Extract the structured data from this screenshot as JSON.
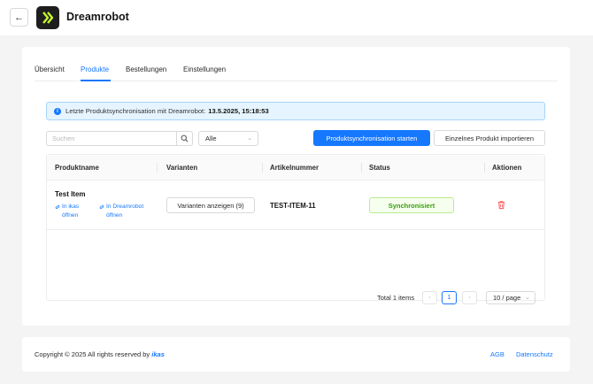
{
  "header": {
    "back_icon": "arrow-left-icon",
    "logo_icon": "double-chevron-right-icon",
    "title": "Dreamrobot"
  },
  "tabs": [
    {
      "label": "Übersicht",
      "active": false
    },
    {
      "label": "Produkte",
      "active": true
    },
    {
      "label": "Bestellungen",
      "active": false
    },
    {
      "label": "Einstellungen",
      "active": false
    }
  ],
  "alert": {
    "icon": "info-icon",
    "text": "Letzte Produktsynchronisation mit Dreamrobot:",
    "timestamp": "13.5.2025, 15:18:53"
  },
  "toolbar": {
    "search_placeholder": "Suchen",
    "filter_value": "Alle",
    "sync_button": "Produktsynchronisation starten",
    "import_button": "Einzelnes Produkt importieren"
  },
  "table": {
    "columns": [
      "Produktname",
      "Varianten",
      "Artikelnummer",
      "Status",
      "Aktionen"
    ],
    "rows": [
      {
        "name": "Test Item",
        "link_ikas": "In ikas öffnen",
        "link_dreamrobot": "In Dreamrobot öffnen",
        "variants_button": "Varianten anzeigen (9)",
        "sku": "TEST-ITEM-11",
        "status": "Synchronisiert",
        "action_icon": "trash-icon"
      }
    ]
  },
  "pagination": {
    "total": "Total 1 items",
    "current_page": "1",
    "page_size": "10 / page"
  },
  "footer": {
    "copyright": "Copyright © 2025 All rights reserved by",
    "brand": "ikas",
    "links": [
      "AGB",
      "Datenschutz"
    ]
  },
  "colors": {
    "accent": "#1677ff",
    "success": "#389e0d",
    "danger": "#ff4d4f",
    "background": "#f4f4f5"
  }
}
